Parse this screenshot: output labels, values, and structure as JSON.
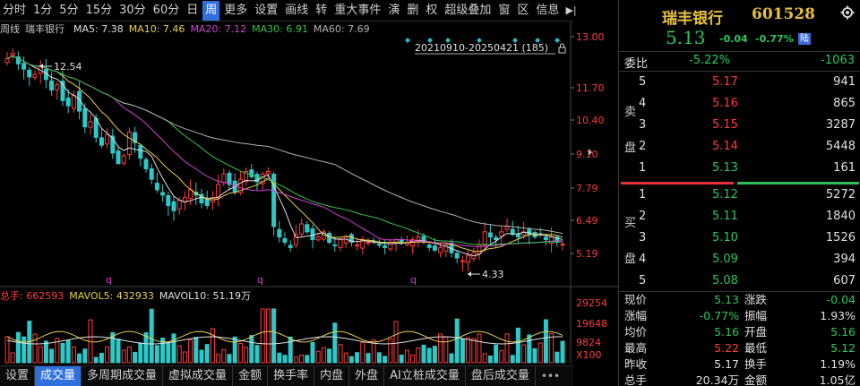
{
  "toolbar": {
    "items": [
      {
        "label": "分时",
        "active": false
      },
      {
        "label": "1分",
        "active": false
      },
      {
        "label": "5分",
        "active": false
      },
      {
        "label": "15分",
        "active": false
      },
      {
        "label": "30分",
        "active": false
      },
      {
        "label": "60分",
        "active": false
      },
      {
        "label": "日",
        "active": false
      },
      {
        "label": "周",
        "active": true
      },
      {
        "label": "更多",
        "active": false
      },
      {
        "label": "设置",
        "active": false
      },
      {
        "label": "画线",
        "active": false
      },
      {
        "label": "转",
        "active": false
      },
      {
        "label": "重大事件",
        "active": false
      },
      {
        "label": "演",
        "active": false
      },
      {
        "label": "删",
        "active": false
      },
      {
        "label": "权",
        "active": false
      },
      {
        "label": "超级叠加",
        "active": false
      },
      {
        "label": "窗",
        "active": false
      },
      {
        "label": "区",
        "active": false
      },
      {
        "label": "信息",
        "active": false
      }
    ],
    "arrow_label": "▶|"
  },
  "ma_legend": {
    "period": "周线",
    "name": "瑞丰银行",
    "items": [
      {
        "label": "MA5: 7.38",
        "color": "#e0e0e0"
      },
      {
        "label": "MA10: 7.46",
        "color": "#e8d04a"
      },
      {
        "label": "MA20: 7.12",
        "color": "#d040d0"
      },
      {
        "label": "MA30: 6.91",
        "color": "#36c24a"
      },
      {
        "label": "MA60: 7.69",
        "color": "#b0b0b0"
      }
    ]
  },
  "range_label": "20210910-20250421 (185)",
  "price_axis": [
    "13.00",
    "11.70",
    "10.40",
    "9.10",
    "7.79",
    "6.49",
    "5.19"
  ],
  "high_label": "12.54",
  "low_label": "4.33",
  "q_markers": [
    "q",
    "q",
    "q"
  ],
  "volume_legend": {
    "total": "总手: 662593",
    "mavol5": "MAVOL5: 432933",
    "mavol10": "MAVOL10: 51.19万"
  },
  "volume_axis": [
    "29254",
    "19648",
    "9824",
    "X100"
  ],
  "bottom_tabs": [
    {
      "label": "设置",
      "active": false
    },
    {
      "label": "成交量",
      "active": true
    },
    {
      "label": "多周期成交量",
      "active": false
    },
    {
      "label": "虚拟成交量",
      "active": false
    },
    {
      "label": "金额",
      "active": false
    },
    {
      "label": "换手率",
      "active": false
    },
    {
      "label": "内盘",
      "active": false
    },
    {
      "label": "外盘",
      "active": false
    },
    {
      "label": "AI立桩成交量",
      "active": false
    },
    {
      "label": "盘后成交量",
      "active": false
    }
  ],
  "bottom_more": "•••",
  "quote": {
    "name": "瑞丰银行",
    "code": "601528",
    "price": "5.13",
    "change": "-0.04",
    "change_pct": "-0.77%",
    "badge": "陆",
    "weibi_label": "委比",
    "weibi_pct": "-5.22%",
    "weibi_diff": "-1063",
    "sell_label_1": "卖",
    "sell_label_2": "盘",
    "buy_label_1": "买",
    "buy_label_2": "盘",
    "sells": [
      {
        "level": "5",
        "price": "5.17",
        "vol": "941"
      },
      {
        "level": "4",
        "price": "5.16",
        "vol": "865"
      },
      {
        "level": "3",
        "price": "5.15",
        "vol": "3287"
      },
      {
        "level": "2",
        "price": "5.14",
        "vol": "5448"
      },
      {
        "level": "1",
        "price": "5.13",
        "vol": "161"
      }
    ],
    "buys": [
      {
        "level": "1",
        "price": "5.12",
        "vol": "5272"
      },
      {
        "level": "2",
        "price": "5.11",
        "vol": "1840"
      },
      {
        "level": "3",
        "price": "5.10",
        "vol": "1526"
      },
      {
        "level": "4",
        "price": "5.09",
        "vol": "394"
      },
      {
        "level": "5",
        "price": "5.08",
        "vol": "607"
      }
    ],
    "stats": [
      {
        "l1": "现价",
        "v1": "5.13",
        "c1": "green",
        "l2": "涨跌",
        "v2": "-0.04",
        "c2": "green"
      },
      {
        "l1": "涨幅",
        "v1": "-0.77%",
        "c1": "green",
        "l2": "振幅",
        "v2": "1.93%",
        "c2": "white"
      },
      {
        "l1": "均价",
        "v1": "5.16",
        "c1": "green",
        "l2": "开盘",
        "v2": "5.16",
        "c2": "green"
      },
      {
        "l1": "最高",
        "v1": "5.22",
        "c1": "red",
        "l2": "最低",
        "v2": "5.12",
        "c2": "green"
      },
      {
        "l1": "昨收",
        "v1": "5.17",
        "c1": "white",
        "l2": "换手",
        "v2": "1.19%",
        "c2": "white"
      },
      {
        "l1": "总手",
        "v1": "20.34万",
        "c1": "white",
        "l2": "金额",
        "v2": "1.05亿",
        "c2": "white"
      }
    ]
  },
  "chart_data": {
    "type": "candlestick",
    "price_ylim": [
      4.33,
      13.0
    ],
    "candles_close": [
      12.2,
      12.4,
      12.0,
      11.8,
      11.5,
      11.6,
      11.9,
      11.4,
      11.0,
      11.2,
      10.6,
      10.4,
      10.8,
      10.2,
      9.6,
      9.8,
      9.2,
      8.9,
      9.3,
      8.6,
      8.2,
      8.5,
      9.4,
      9.0,
      8.4,
      8.0,
      7.6,
      7.2,
      7.0,
      6.6,
      6.4,
      6.8,
      6.9,
      7.2,
      7.0,
      6.7,
      6.6,
      6.9,
      7.4,
      7.8,
      7.4,
      7.1,
      7.6,
      7.9,
      7.7,
      7.5,
      7.8,
      7.9,
      5.8,
      5.4,
      5.2,
      5.0,
      5.5,
      5.9,
      5.6,
      5.3,
      5.4,
      5.6,
      5.2,
      5.1,
      5.3,
      5.4,
      5.2,
      5.1,
      5.3,
      5.2,
      5.2,
      5.1,
      5.0,
      5.2,
      5.3,
      5.2,
      5.2,
      5.3,
      5.4,
      5.2,
      5.0,
      4.9,
      5.0,
      5.1,
      4.8,
      4.6,
      4.5,
      4.7,
      4.8,
      5.1,
      5.6,
      5.4,
      5.3,
      5.6,
      5.8,
      5.5,
      5.4,
      5.6,
      5.5,
      5.4,
      5.5,
      5.3,
      5.4,
      5.2,
      5.13
    ],
    "volume_ylim": [
      0,
      29254
    ]
  }
}
